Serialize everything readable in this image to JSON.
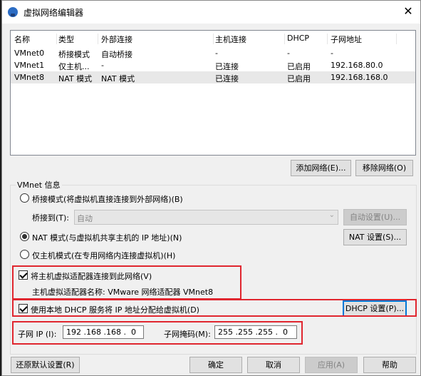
{
  "window": {
    "title": "虚拟网络编辑器",
    "close_icon": "close-icon"
  },
  "list": {
    "columns": [
      "名称",
      "类型",
      "外部连接",
      "主机连接",
      "DHCP",
      "子网地址"
    ],
    "rows": [
      [
        "VMnet0",
        "桥接模式",
        "自动桥接",
        "-",
        "-",
        "-"
      ],
      [
        "VMnet1",
        "仅主机...",
        "-",
        "已连接",
        "已启用",
        "192.168.80.0"
      ],
      [
        "VMnet8",
        "NAT 模式",
        "NAT 模式",
        "已连接",
        "已启用",
        "192.168.168.0"
      ]
    ],
    "selected_row": 2
  },
  "buttons": {
    "add_network": "添加网络(E)...",
    "remove_network": "移除网络(O)",
    "auto_settings": "自动设置(U)...",
    "nat_settings": "NAT 设置(S)...",
    "dhcp_settings": "DHCP 设置(P)...",
    "restore_defaults": "还原默认设置(R)",
    "ok": "确定",
    "cancel": "取消",
    "apply": "应用(A)",
    "help": "帮助"
  },
  "vmnet_info": {
    "group_label": "VMnet 信息",
    "bridge_mode": "桥接模式(将虚拟机直接连接到外部网络)(B)",
    "bridge_to_label": "桥接到(T):",
    "bridge_to_value": "自动",
    "nat_mode": "NAT 模式(与虚拟机共享主机的 IP 地址)(N)",
    "host_only_mode": "仅主机模式(在专用网络内连接虚拟机)(H)",
    "selected_mode": "nat",
    "connect_adapter": "将主机虚拟适配器连接到此网络(V)",
    "connect_adapter_checked": true,
    "adapter_name_line": "主机虚拟适配器名称: VMware 网络适配器 VMnet8",
    "use_dhcp": "使用本地 DHCP 服务将 IP 地址分配给虚拟机(D)",
    "use_dhcp_checked": true,
    "subnet_ip_label": "子网 IP (I):",
    "subnet_ip_value": "192 .168 .168 .  0",
    "subnet_mask_label": "子网掩码(M):",
    "subnet_mask_value": "255 .255 .255 .  0"
  },
  "colors": {
    "highlight_box": "#e0262f",
    "focus_blue": "#0078d7"
  }
}
